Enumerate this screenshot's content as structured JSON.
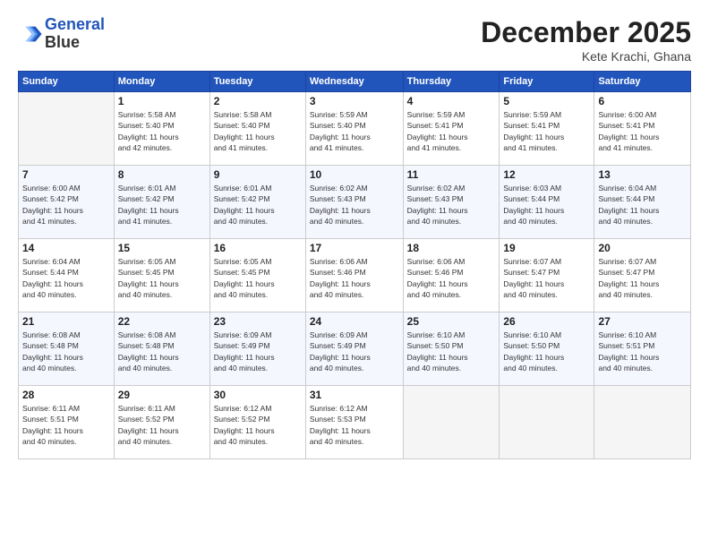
{
  "logo": {
    "line1": "General",
    "line2": "Blue"
  },
  "title": "December 2025",
  "location": "Kete Krachi, Ghana",
  "headers": [
    "Sunday",
    "Monday",
    "Tuesday",
    "Wednesday",
    "Thursday",
    "Friday",
    "Saturday"
  ],
  "weeks": [
    [
      {
        "day": "",
        "info": ""
      },
      {
        "day": "1",
        "info": "Sunrise: 5:58 AM\nSunset: 5:40 PM\nDaylight: 11 hours\nand 42 minutes."
      },
      {
        "day": "2",
        "info": "Sunrise: 5:58 AM\nSunset: 5:40 PM\nDaylight: 11 hours\nand 41 minutes."
      },
      {
        "day": "3",
        "info": "Sunrise: 5:59 AM\nSunset: 5:40 PM\nDaylight: 11 hours\nand 41 minutes."
      },
      {
        "day": "4",
        "info": "Sunrise: 5:59 AM\nSunset: 5:41 PM\nDaylight: 11 hours\nand 41 minutes."
      },
      {
        "day": "5",
        "info": "Sunrise: 5:59 AM\nSunset: 5:41 PM\nDaylight: 11 hours\nand 41 minutes."
      },
      {
        "day": "6",
        "info": "Sunrise: 6:00 AM\nSunset: 5:41 PM\nDaylight: 11 hours\nand 41 minutes."
      }
    ],
    [
      {
        "day": "7",
        "info": "Sunrise: 6:00 AM\nSunset: 5:42 PM\nDaylight: 11 hours\nand 41 minutes."
      },
      {
        "day": "8",
        "info": "Sunrise: 6:01 AM\nSunset: 5:42 PM\nDaylight: 11 hours\nand 41 minutes."
      },
      {
        "day": "9",
        "info": "Sunrise: 6:01 AM\nSunset: 5:42 PM\nDaylight: 11 hours\nand 40 minutes."
      },
      {
        "day": "10",
        "info": "Sunrise: 6:02 AM\nSunset: 5:43 PM\nDaylight: 11 hours\nand 40 minutes."
      },
      {
        "day": "11",
        "info": "Sunrise: 6:02 AM\nSunset: 5:43 PM\nDaylight: 11 hours\nand 40 minutes."
      },
      {
        "day": "12",
        "info": "Sunrise: 6:03 AM\nSunset: 5:44 PM\nDaylight: 11 hours\nand 40 minutes."
      },
      {
        "day": "13",
        "info": "Sunrise: 6:04 AM\nSunset: 5:44 PM\nDaylight: 11 hours\nand 40 minutes."
      }
    ],
    [
      {
        "day": "14",
        "info": "Sunrise: 6:04 AM\nSunset: 5:44 PM\nDaylight: 11 hours\nand 40 minutes."
      },
      {
        "day": "15",
        "info": "Sunrise: 6:05 AM\nSunset: 5:45 PM\nDaylight: 11 hours\nand 40 minutes."
      },
      {
        "day": "16",
        "info": "Sunrise: 6:05 AM\nSunset: 5:45 PM\nDaylight: 11 hours\nand 40 minutes."
      },
      {
        "day": "17",
        "info": "Sunrise: 6:06 AM\nSunset: 5:46 PM\nDaylight: 11 hours\nand 40 minutes."
      },
      {
        "day": "18",
        "info": "Sunrise: 6:06 AM\nSunset: 5:46 PM\nDaylight: 11 hours\nand 40 minutes."
      },
      {
        "day": "19",
        "info": "Sunrise: 6:07 AM\nSunset: 5:47 PM\nDaylight: 11 hours\nand 40 minutes."
      },
      {
        "day": "20",
        "info": "Sunrise: 6:07 AM\nSunset: 5:47 PM\nDaylight: 11 hours\nand 40 minutes."
      }
    ],
    [
      {
        "day": "21",
        "info": "Sunrise: 6:08 AM\nSunset: 5:48 PM\nDaylight: 11 hours\nand 40 minutes."
      },
      {
        "day": "22",
        "info": "Sunrise: 6:08 AM\nSunset: 5:48 PM\nDaylight: 11 hours\nand 40 minutes."
      },
      {
        "day": "23",
        "info": "Sunrise: 6:09 AM\nSunset: 5:49 PM\nDaylight: 11 hours\nand 40 minutes."
      },
      {
        "day": "24",
        "info": "Sunrise: 6:09 AM\nSunset: 5:49 PM\nDaylight: 11 hours\nand 40 minutes."
      },
      {
        "day": "25",
        "info": "Sunrise: 6:10 AM\nSunset: 5:50 PM\nDaylight: 11 hours\nand 40 minutes."
      },
      {
        "day": "26",
        "info": "Sunrise: 6:10 AM\nSunset: 5:50 PM\nDaylight: 11 hours\nand 40 minutes."
      },
      {
        "day": "27",
        "info": "Sunrise: 6:10 AM\nSunset: 5:51 PM\nDaylight: 11 hours\nand 40 minutes."
      }
    ],
    [
      {
        "day": "28",
        "info": "Sunrise: 6:11 AM\nSunset: 5:51 PM\nDaylight: 11 hours\nand 40 minutes."
      },
      {
        "day": "29",
        "info": "Sunrise: 6:11 AM\nSunset: 5:52 PM\nDaylight: 11 hours\nand 40 minutes."
      },
      {
        "day": "30",
        "info": "Sunrise: 6:12 AM\nSunset: 5:52 PM\nDaylight: 11 hours\nand 40 minutes."
      },
      {
        "day": "31",
        "info": "Sunrise: 6:12 AM\nSunset: 5:53 PM\nDaylight: 11 hours\nand 40 minutes."
      },
      {
        "day": "",
        "info": ""
      },
      {
        "day": "",
        "info": ""
      },
      {
        "day": "",
        "info": ""
      }
    ]
  ]
}
